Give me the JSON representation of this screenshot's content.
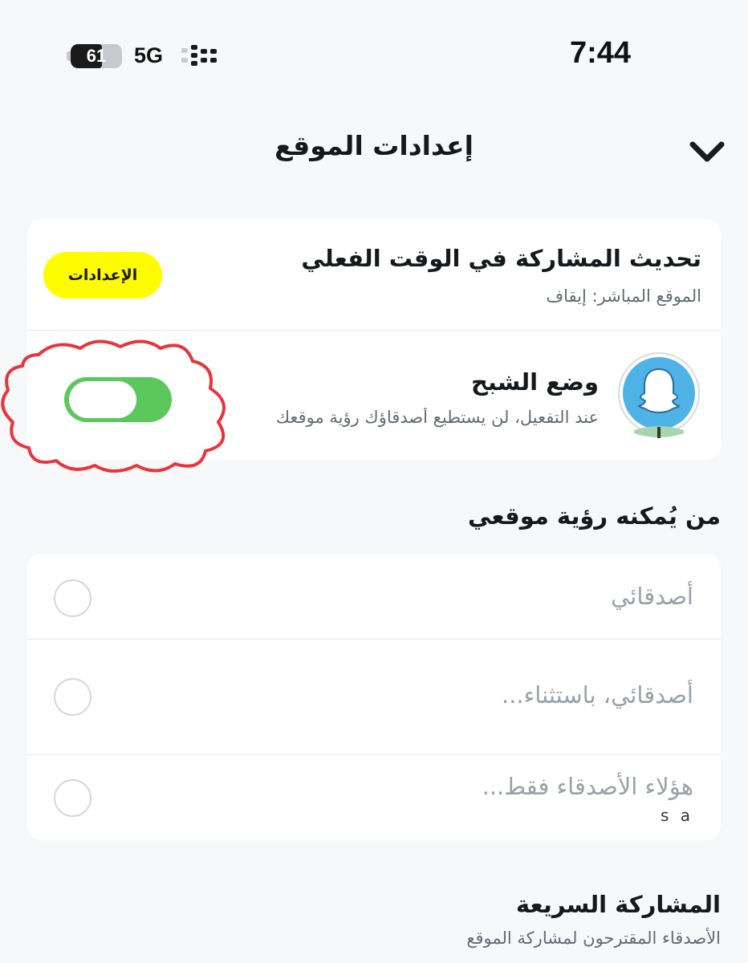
{
  "status_bar": {
    "battery_level": "61",
    "battery_fraction": 0.61,
    "network": "5G",
    "time": "7:44"
  },
  "header": {
    "title": "إعدادات الموقع",
    "collapse_icon": "chevron-down-icon"
  },
  "live_sharing": {
    "title": "تحديث المشاركة في الوقت الفعلي",
    "subtitle": "الموقع المباشر: إيقاف",
    "settings_button": "الإعدادات"
  },
  "ghost_mode": {
    "title": "وضع الشبح",
    "subtitle": "عند التفعيل، لن يستطيع أصدقاؤك رؤية موقعك",
    "enabled": true,
    "avatar_icon": "ghost-icon"
  },
  "visibility": {
    "title": "من يُمكنه رؤية موقعي",
    "options": [
      {
        "label": "أصدقائي",
        "selected": false
      },
      {
        "label": "أصدقائي، باستثناء...",
        "selected": false
      },
      {
        "label": "هؤلاء الأصدقاء فقط...",
        "sub": "s a",
        "selected": false
      }
    ]
  },
  "quick_share": {
    "title": "المشاركة السريعة",
    "subtitle": "الأصدقاء المقترحون لمشاركة الموقع"
  },
  "colors": {
    "accent_yellow": "#fffc00",
    "toggle_on": "#5cc75c",
    "background": "#f7f8f9",
    "annotation_red": "#e8343a",
    "avatar_blue": "#4fb3e8"
  }
}
